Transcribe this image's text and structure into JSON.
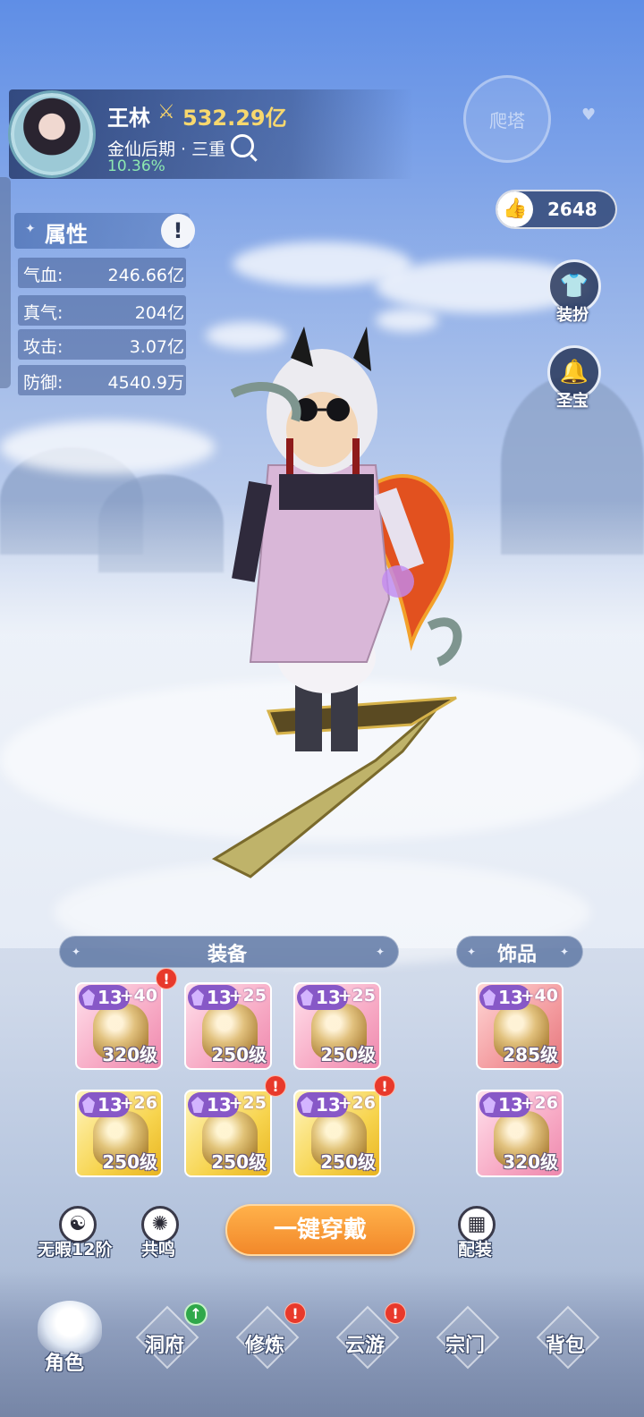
{
  "player": {
    "name": "王林",
    "power": "532.29亿",
    "realm": "金仙后期 · 三重",
    "progress": "10.36%"
  },
  "top_right": {
    "climb_label": "爬塔",
    "likes": "2648"
  },
  "side_menu": {
    "outfit_label": "装扮",
    "treasure_label": "圣宝"
  },
  "attributes": {
    "title": "属性",
    "info_icon": "!",
    "rows": [
      {
        "label": "气血:",
        "value": "246.66亿"
      },
      {
        "label": "真气:",
        "value": "204亿"
      },
      {
        "label": "攻击:",
        "value": "3.07亿"
      },
      {
        "label": "防御:",
        "value": "4540.9万"
      }
    ]
  },
  "equipment": {
    "title": "装备",
    "slots": [
      {
        "grade": "13",
        "plus": "+40",
        "level": "320级",
        "rarity": "pink",
        "alert": true,
        "icon": "sword-icon"
      },
      {
        "grade": "13",
        "plus": "+25",
        "level": "250级",
        "rarity": "pink",
        "alert": false,
        "icon": "helmet-icon"
      },
      {
        "grade": "13",
        "plus": "+25",
        "level": "250级",
        "rarity": "pink",
        "alert": false,
        "icon": "armor-icon"
      },
      {
        "grade": "13",
        "plus": "+26",
        "level": "250级",
        "rarity": "gold",
        "alert": false,
        "icon": "leg-armor-icon"
      },
      {
        "grade": "13",
        "plus": "+25",
        "level": "250级",
        "rarity": "gold",
        "alert": true,
        "icon": "gauntlet-icon"
      },
      {
        "grade": "13",
        "plus": "+26",
        "level": "250级",
        "rarity": "gold",
        "alert": true,
        "icon": "boots-icon"
      }
    ]
  },
  "accessories": {
    "title": "饰品",
    "slots": [
      {
        "grade": "13",
        "plus": "+40",
        "level": "285级",
        "rarity": "red",
        "icon": "bracelet-icon"
      },
      {
        "grade": "13",
        "plus": "+26",
        "level": "320级",
        "rarity": "pink",
        "icon": "pendant-icon"
      }
    ]
  },
  "actions": {
    "flawless_label": "无暇12阶",
    "resonance_label": "共鸣",
    "equip_all_label": "一键穿戴",
    "loadout_label": "配装"
  },
  "nav": {
    "items": [
      {
        "label": "角色",
        "active": true
      },
      {
        "label": "洞府",
        "badge": "up"
      },
      {
        "label": "修炼",
        "badge": "alert"
      },
      {
        "label": "云游",
        "badge": "alert"
      },
      {
        "label": "宗门"
      },
      {
        "label": "背包"
      }
    ]
  },
  "colors": {
    "accent_orange": "#f2882a",
    "power_gold": "#f8d86e",
    "progress_green": "#8de8b0",
    "alert_red": "#e8392b",
    "grade_purple": "#8758c7"
  }
}
